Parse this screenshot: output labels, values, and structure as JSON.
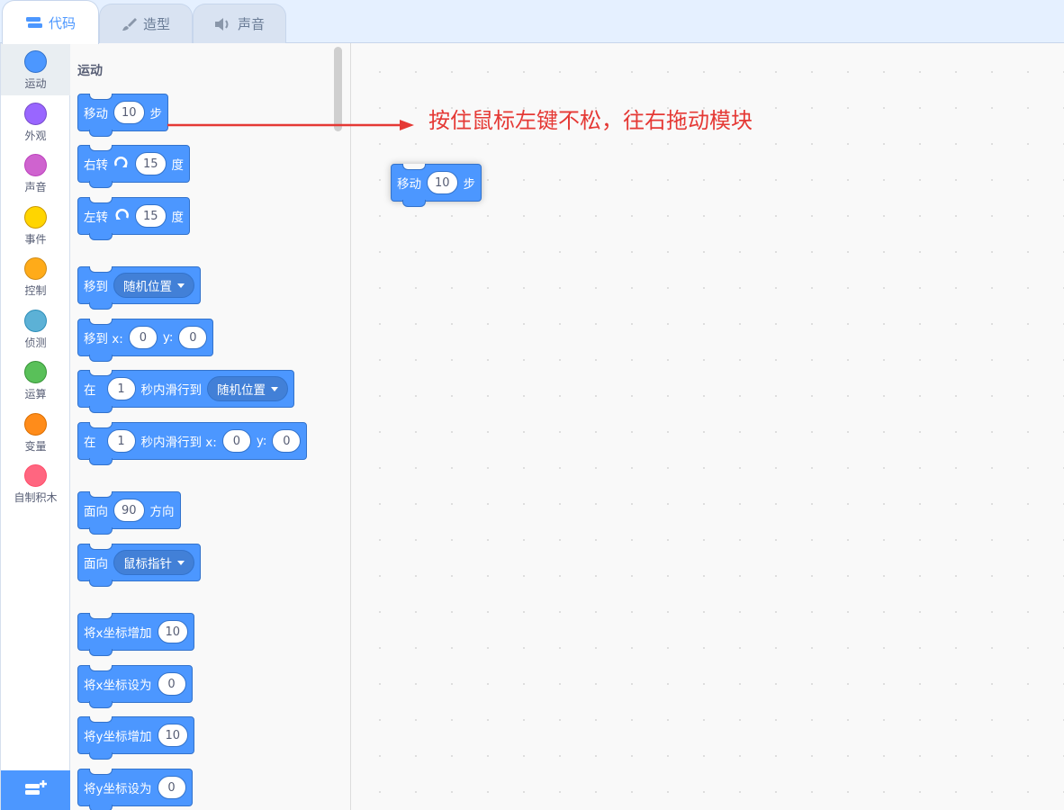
{
  "tabs": [
    {
      "label": "代码",
      "icon": "code-icon",
      "active": true
    },
    {
      "label": "造型",
      "icon": "brush-icon",
      "active": false
    },
    {
      "label": "声音",
      "icon": "speaker-icon",
      "active": false
    }
  ],
  "categories": [
    {
      "label": "运动",
      "color": "#4c97ff"
    },
    {
      "label": "外观",
      "color": "#9966ff"
    },
    {
      "label": "声音",
      "color": "#cf63cf"
    },
    {
      "label": "事件",
      "color": "#ffd500"
    },
    {
      "label": "控制",
      "color": "#ffab19"
    },
    {
      "label": "侦测",
      "color": "#5cb1d6"
    },
    {
      "label": "运算",
      "color": "#59c059"
    },
    {
      "label": "变量",
      "color": "#ff8c1a"
    },
    {
      "label": "自制积木",
      "color": "#ff6680"
    }
  ],
  "extension_button_icon": "add-extension-icon",
  "palette": {
    "title": "运动",
    "blocks": {
      "move": {
        "a": "移动",
        "steps": "10",
        "b": "步"
      },
      "turn_right": {
        "a": "右转",
        "deg": "15",
        "b": "度"
      },
      "turn_left": {
        "a": "左转",
        "deg": "15",
        "b": "度"
      },
      "goto": {
        "a": "移到",
        "target": "随机位置"
      },
      "goto_xy": {
        "a": "移到 x:",
        "x": "0",
        "b": "y:",
        "y": "0"
      },
      "glide": {
        "a": "在",
        "secs": "1",
        "b": "秒内滑行到",
        "target": "随机位置"
      },
      "glide_xy": {
        "a": "在",
        "secs": "1",
        "b": "秒内滑行到 x:",
        "x": "0",
        "c": "y:",
        "y": "0"
      },
      "point_dir": {
        "a": "面向",
        "dir": "90",
        "b": "方向"
      },
      "point_towards": {
        "a": "面向",
        "target": "鼠标指针"
      },
      "change_x": {
        "a": "将x坐标增加",
        "value": "10"
      },
      "set_x": {
        "a": "将x坐标设为",
        "value": "0"
      },
      "change_y": {
        "a": "将y坐标增加",
        "value": "10"
      },
      "set_y": {
        "a": "将y坐标设为",
        "value": "0"
      }
    }
  },
  "workspace": {
    "hint": "按住鼠标左键不松，往右拖动模块",
    "hint_color": "#e53935",
    "block": {
      "a": "移动",
      "steps": "10",
      "b": "步"
    }
  }
}
